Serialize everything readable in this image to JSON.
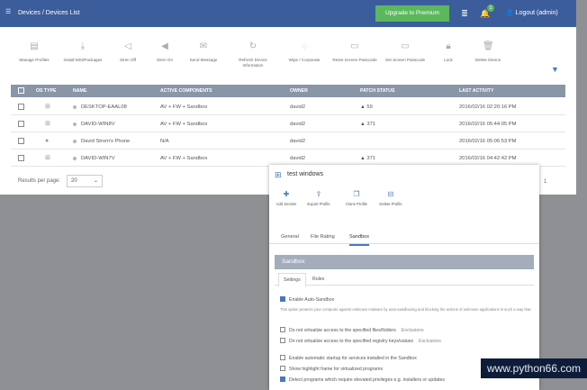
{
  "topbar": {
    "breadcrumb": [
      "Devices",
      "/",
      "Devices List"
    ],
    "upgrade_label": "Upgrade to Premium",
    "notification_count": "1",
    "logout_label": "Logout (admin)"
  },
  "toolbar": {
    "items": [
      {
        "label": "Manage Profiles",
        "icon": "profiles-icon"
      },
      {
        "label": "Install MSI/Packages",
        "icon": "install-icon"
      },
      {
        "label": "Siren Off",
        "icon": "siren-off-icon"
      },
      {
        "label": "Siren On",
        "icon": "siren-on-icon"
      },
      {
        "label": "Send Message",
        "icon": "message-icon"
      },
      {
        "label": "Refresh Device Information",
        "icon": "refresh-icon"
      },
      {
        "label": "Wipe / Corporate",
        "icon": "wipe-icon"
      },
      {
        "label": "Reset Screen Passcode",
        "icon": "reset-passcode-icon"
      },
      {
        "label": "Set Screen Passcode",
        "icon": "set-passcode-icon"
      },
      {
        "label": "Lock",
        "icon": "lock-icon"
      },
      {
        "label": "Delete Device",
        "icon": "delete-icon"
      }
    ]
  },
  "table": {
    "columns": [
      "OS TYPE",
      "NAME",
      "ACTIVE COMPONENTS",
      "OWNER",
      "PATCH STATUS",
      "LAST ACTIVITY"
    ],
    "rows": [
      {
        "os": "windows",
        "name": "DESKTOP-EAAL08",
        "components": "AV + FW + Sandbox",
        "owner": "david2",
        "patch": "59",
        "activity": "2016/02/16 02:20:16 PM"
      },
      {
        "os": "windows",
        "name": "DAVID-WIN8V",
        "components": "AV + FW + Sandbox",
        "owner": "david2",
        "patch": "371",
        "activity": "2016/02/16 05:44:05 PM"
      },
      {
        "os": "apple",
        "name": "David Strom's Phone",
        "components": "N/A",
        "owner": "david2",
        "patch": "",
        "activity": "2016/02/16 05:06:53 PM"
      },
      {
        "os": "windows",
        "name": "DAVID-WIN7V",
        "components": "AV + FW + Sandbox",
        "owner": "david2",
        "patch": "371",
        "activity": "2016/02/16 04:42:42 PM"
      }
    ]
  },
  "footer": {
    "results_label": "Results per page:",
    "results_value": "20",
    "page_number": "1"
  },
  "panel": {
    "title": "test windows",
    "tools": [
      "Add Section",
      "Export Profile",
      "Clone Profile",
      "Delete Profile"
    ],
    "tabs": [
      "General",
      "File Rating",
      "Sandbox"
    ],
    "section_title": "Sandbox",
    "subtabs": [
      "Settings",
      "Rules"
    ],
    "enable_label": "Enable Auto-Sandbox",
    "description": "This option protects your computer against unknown malware by auto-sandboxing and blocking the actions of unknown applications in such a way that they applications can not harm your computer.",
    "options": [
      {
        "label": "Do not virtualize access to the specified files/folders",
        "link": "Exclusions",
        "checked": false
      },
      {
        "label": "Do not virtualize access to the specified registry keys/values",
        "link": "Exclusions",
        "checked": false
      },
      {
        "label": "Enable automatic startup for services installed in the Sandbox",
        "link": "",
        "checked": false
      },
      {
        "label": "Show highlight frame for virtualized programs",
        "link": "",
        "checked": false
      },
      {
        "label": "Detect programs which require elevated privileges e.g. installers or updates",
        "link": "",
        "checked": true
      }
    ]
  },
  "watermark": "www.python66.com",
  "colors": {
    "header": "#3b5d9b",
    "upgrade": "#5cb85c",
    "table_head": "#8996a8",
    "accent": "#4a78c0"
  }
}
